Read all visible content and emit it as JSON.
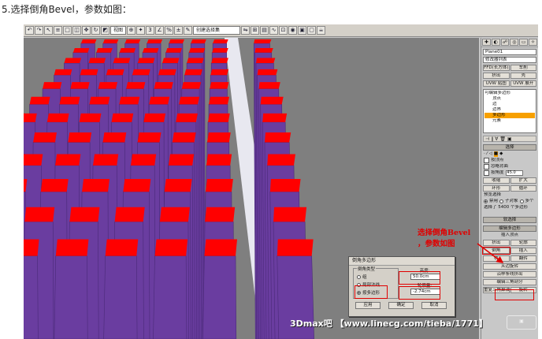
{
  "caption": "5.选择倒角Bevel，参数如图：",
  "toolbar": {
    "view_select": "视图",
    "selection_set": "创建选择集"
  },
  "panel": {
    "object_name": "Plane01",
    "modifier_list": "修改器列表",
    "buttons_row1": [
      "FFD(长方体)",
      "车削"
    ],
    "buttons_row2": [
      "挤出",
      "壳"
    ],
    "buttons_row3": [
      "UVW 贴图",
      "UVW 展开"
    ],
    "stack": [
      {
        "label": "可编辑多边形",
        "active": false
      },
      {
        "label": "顶点",
        "active": false
      },
      {
        "label": "边",
        "active": false
      },
      {
        "label": "边界",
        "active": false
      },
      {
        "label": "多边形",
        "active": true
      },
      {
        "label": "元素",
        "active": false
      }
    ],
    "select_rollout": "选择",
    "by_vertex": "按顶点",
    "ignore_backfacing": "忽略背面",
    "by_angle": "按角度",
    "angle_value": "45.0",
    "shrink": "收缩",
    "grow": "扩大",
    "ring": "环形",
    "loop": "循环",
    "preview_label": "预览选择",
    "preview_options": [
      "禁用",
      "子对象",
      "多个"
    ],
    "selected_count": "选择了 5400 个多边形",
    "soft_rollout": "软选择",
    "edit_poly_rollout": "编辑多边形",
    "insert_vertex": "插入顶点",
    "extrude": "挤出",
    "outline": "轮廓",
    "bevel": "倒角",
    "inset": "插入",
    "bridge": "桥",
    "flip": "翻转",
    "hinge_rotate": "从边旋转",
    "extrude_along_spline": "沿样条线挤出",
    "edit_triangulation": "编辑三角剖分",
    "retriangulate": "重复三角算法",
    "turn": "旋转"
  },
  "dialog": {
    "title": "倒角多边形",
    "group_title": "倒角类型",
    "options": [
      "组",
      "局部法线",
      "按多边形"
    ],
    "selected_option": 2,
    "height_label": "高度:",
    "height_value": "50.0cm",
    "outline_label": "轮廓量:",
    "outline_value": "-2.74cm",
    "buttons": [
      "应用",
      "确定",
      "取消"
    ]
  },
  "annotation": {
    "line1": "选择倒角Bevel",
    "line2": "，参数如图"
  },
  "watermark": "3Dmax吧 【www.linecg.com/tieba/1771】",
  "colors": {
    "pillar_side": "#6a3da0",
    "pillar_top": "#ff0000",
    "viewport_bg": "#7f7f7f",
    "panel_bg": "#c8c8c8",
    "highlight": "#e00000",
    "active_item": "#f7a000"
  }
}
